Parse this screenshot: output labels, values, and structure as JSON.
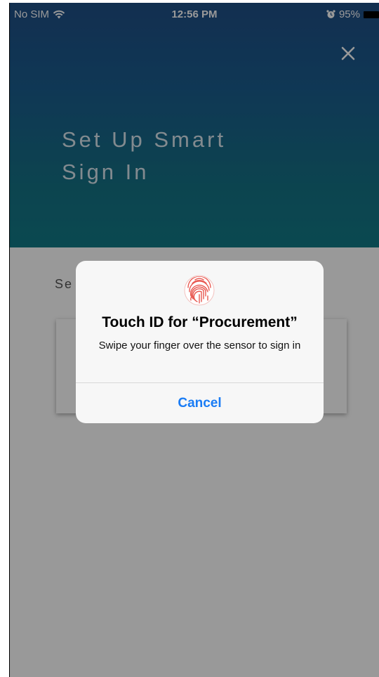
{
  "status_bar": {
    "carrier": "No SIM",
    "time": "12:56 PM",
    "battery": "95%",
    "icons": [
      "wifi-icon",
      "alarm-icon",
      "battery-icon"
    ]
  },
  "header": {
    "title_line1": "Set Up Smart",
    "title_line2": "Sign In",
    "close_icon": "close-icon"
  },
  "body": {
    "label_partial": "Se"
  },
  "alert": {
    "icon": "fingerprint-icon",
    "title": "Touch ID for “Procurement”",
    "message": "Swipe your finger over the sensor to sign in",
    "cancel_label": "Cancel"
  },
  "colors": {
    "header_top": "#1f4f86",
    "header_bottom": "#127a86",
    "accent_blue": "#1a7cf5",
    "fingerprint_red": "#e8574f"
  }
}
